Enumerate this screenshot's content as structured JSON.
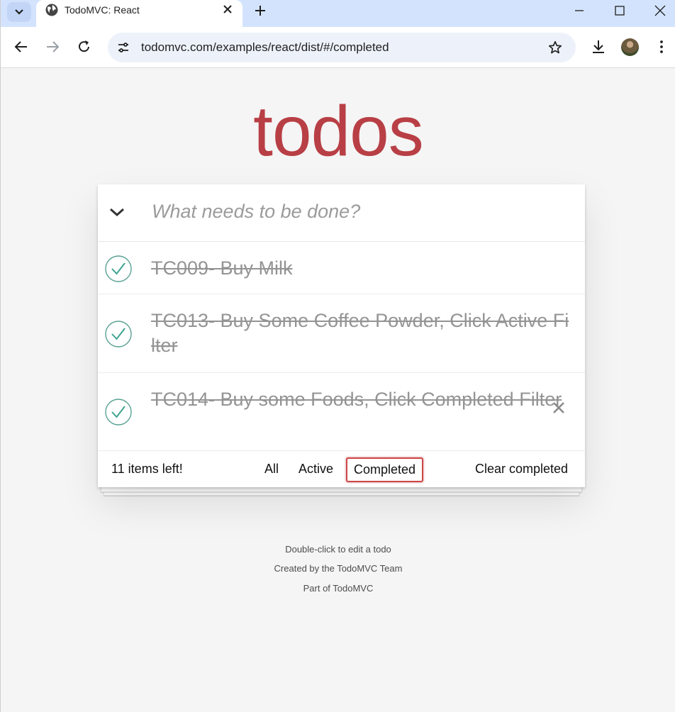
{
  "browser": {
    "tab_title": "TodoMVC: React",
    "url": "todomvc.com/examples/react/dist/#/completed"
  },
  "app": {
    "title": "todos",
    "new_todo_placeholder": "What needs to be done?",
    "todos": [
      {
        "label": "TC009- Buy Milk",
        "completed": true
      },
      {
        "label": "TC013- Buy Some Coffee Powder, Click Active Filter",
        "completed": true
      },
      {
        "label": "TC014- Buy some Foods, Click Completed Filter",
        "completed": true
      }
    ],
    "footer": {
      "count": "11 items left!",
      "filters": [
        "All",
        "Active",
        "Completed"
      ],
      "selected_filter": "Completed",
      "clear_completed": "Clear completed"
    }
  },
  "info": {
    "edit_hint": "Double-click to edit a todo",
    "created_by": "Created by the TodoMVC Team",
    "part_of": "Part of TodoMVC"
  },
  "colors": {
    "accent": "#b83f45",
    "check": "#3ea390",
    "background": "#f5f5f5"
  }
}
